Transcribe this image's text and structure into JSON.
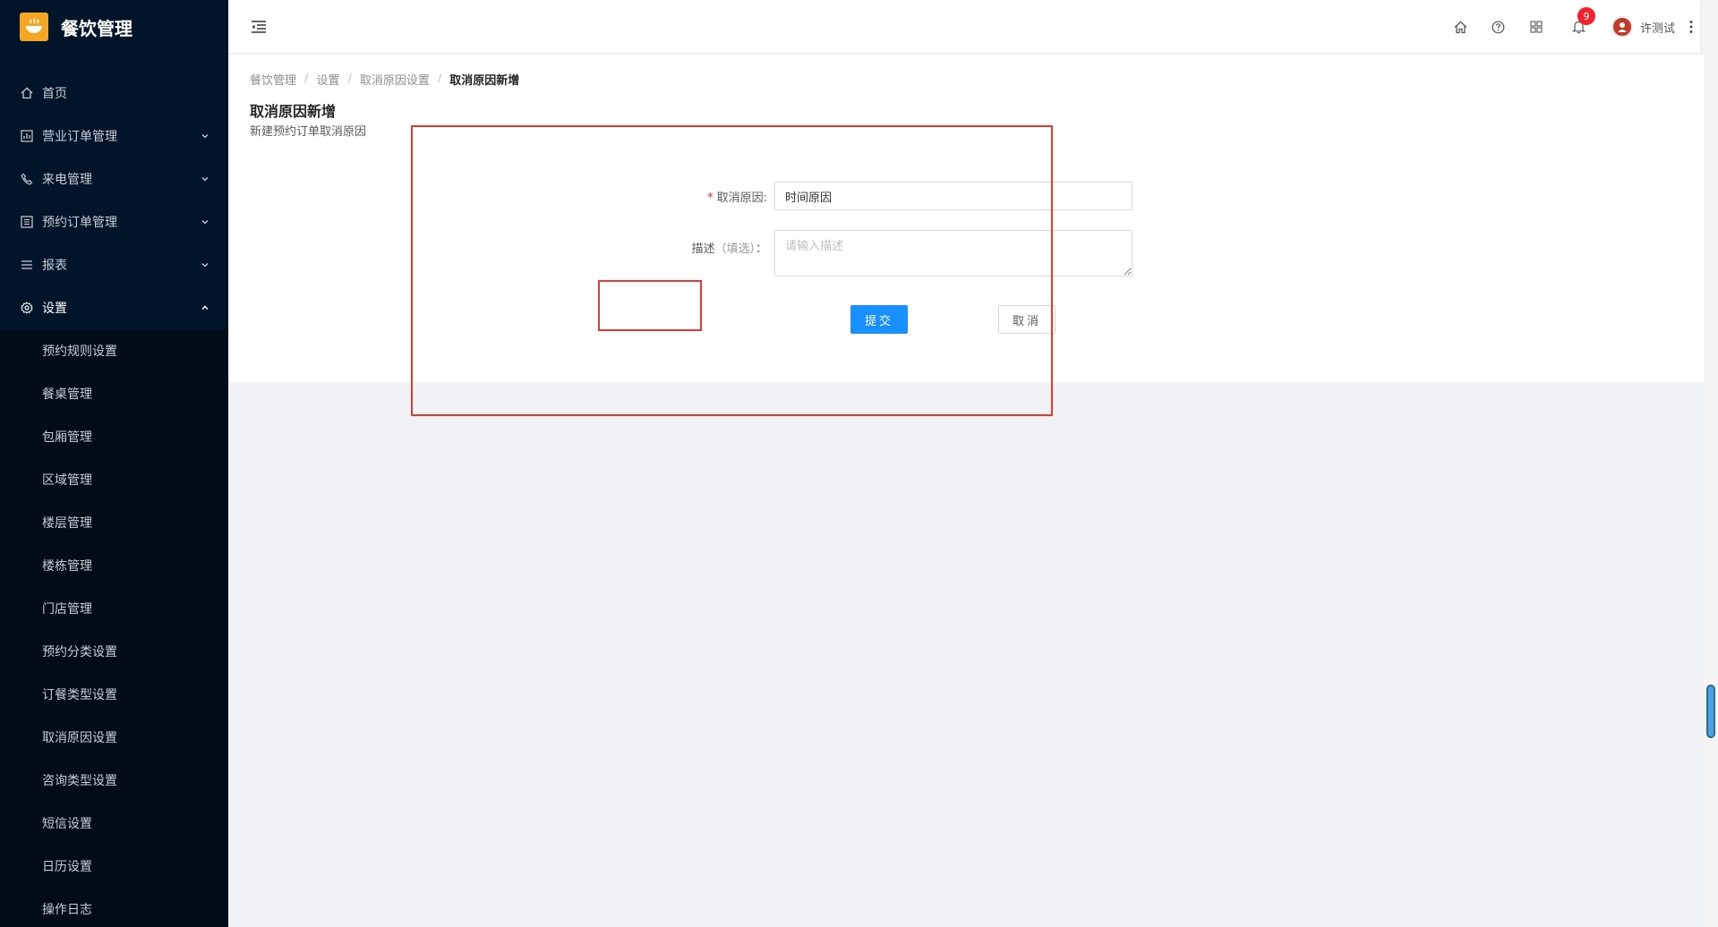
{
  "app": {
    "title": "餐饮管理"
  },
  "sidebar": {
    "items": [
      {
        "label": "首页",
        "icon": "home-icon"
      },
      {
        "label": "营业订单管理",
        "icon": "bar-chart-icon"
      },
      {
        "label": "来电管理",
        "icon": "phone-icon"
      },
      {
        "label": "预约订单管理",
        "icon": "list-icon"
      },
      {
        "label": "报表",
        "icon": "menu-icon"
      },
      {
        "label": "设置",
        "icon": "gear-icon"
      }
    ],
    "sub_items": [
      "预约规则设置",
      "餐桌管理",
      "包厢管理",
      "区域管理",
      "楼层管理",
      "楼栋管理",
      "门店管理",
      "预约分类设置",
      "订餐类型设置",
      "取消原因设置",
      "咨询类型设置",
      "短信设置",
      "日历设置",
      "操作日志"
    ]
  },
  "header": {
    "notification_count": "9",
    "username": "许测试"
  },
  "breadcrumb": {
    "items": [
      "餐饮管理",
      "设置",
      "取消原因设置"
    ],
    "current": "取消原因新增",
    "separator": "/"
  },
  "page": {
    "title": "取消原因新增",
    "description": "新建预约订单取消原因"
  },
  "form": {
    "reason_label": "取消原因:",
    "reason_required_mark": "*",
    "reason_value": "时间原因",
    "desc_label": "描述",
    "desc_hint": "（填选）",
    "desc_colon": "：",
    "desc_placeholder": "请输入描述",
    "submit_label": "提交",
    "cancel_label": "取消"
  },
  "colors": {
    "sidebar_bg": "#001529",
    "primary": "#1890ff",
    "annotation": "#e53935",
    "logo": "#f5a623"
  }
}
